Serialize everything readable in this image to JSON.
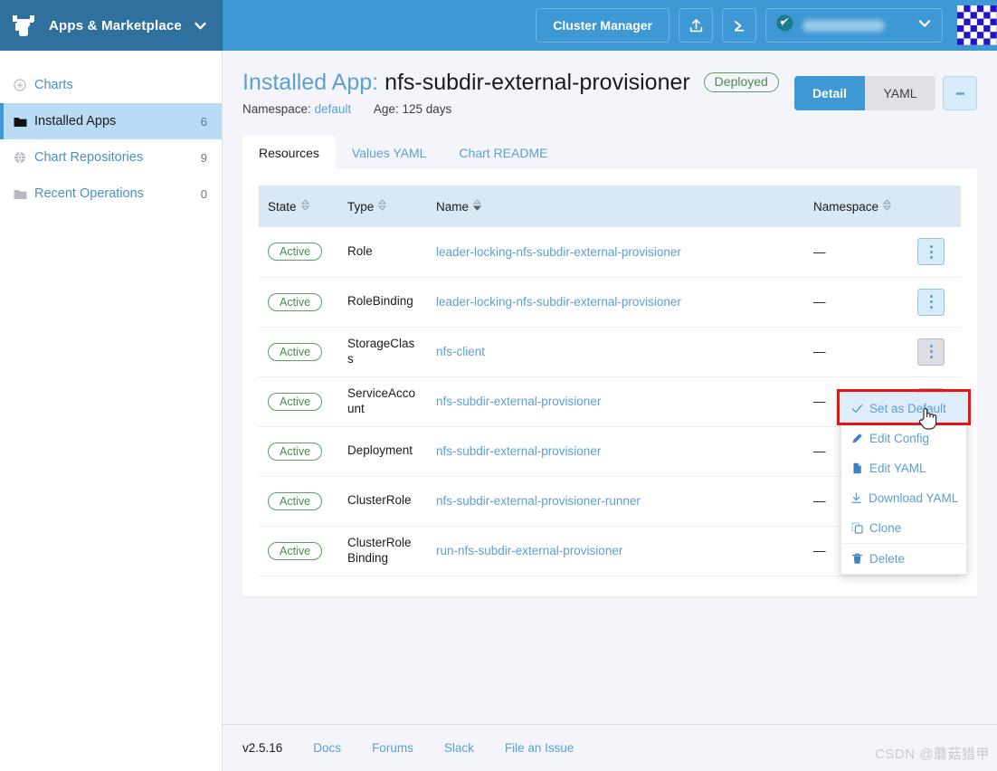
{
  "header": {
    "brand_title": "Apps & Marketplace",
    "brand_logo_icon": "rancher-cow-logo",
    "brand_caret_icon": "chevron-down-icon",
    "cluster_manager_label": "Cluster Manager",
    "import_yaml_icon": "upload-icon",
    "shell_icon": "terminal-icon",
    "cluster_selector_icon": "cluster-icon",
    "cluster_selector_value": "",
    "cluster_selector_caret_icon": "chevron-down-icon",
    "avatar_icon": "user-avatar"
  },
  "sidebar": {
    "items": [
      {
        "label": "Charts",
        "icon": "plus-circle-icon",
        "count": "",
        "active": false
      },
      {
        "label": "Installed Apps",
        "icon": "folder-icon",
        "count": "6",
        "active": true
      },
      {
        "label": "Chart Repositories",
        "icon": "globe-icon",
        "count": "9",
        "active": false
      },
      {
        "label": "Recent Operations",
        "icon": "folder-icon",
        "count": "0",
        "active": false
      }
    ]
  },
  "page": {
    "title_prefix": "Installed App:",
    "title_name": "nfs-subdir-external-provisioner",
    "status_badge": "Deployed",
    "namespace_label": "Namespace:",
    "namespace_value": "default",
    "age_label": "Age:",
    "age_value": "125 days",
    "view_detail": "Detail",
    "view_yaml": "YAML",
    "actions_icon": "kebab-menu-icon"
  },
  "tabs": [
    {
      "label": "Resources",
      "active": true
    },
    {
      "label": "Values YAML",
      "active": false
    },
    {
      "label": "Chart README",
      "active": false
    }
  ],
  "table": {
    "columns": [
      {
        "label": "State",
        "sort_icon": "sort-icon"
      },
      {
        "label": "Type",
        "sort_icon": "sort-icon"
      },
      {
        "label": "Name",
        "sort_icon": "sort-icon-active"
      },
      {
        "label": "Namespace",
        "sort_icon": "sort-icon"
      }
    ],
    "rows": [
      {
        "state": "Active",
        "type": "Role",
        "name": "leader-locking-nfs-subdir-external-provisioner",
        "namespace": "—",
        "menu_open": false
      },
      {
        "state": "Active",
        "type": "RoleBinding",
        "name": "leader-locking-nfs-subdir-external-provisioner",
        "namespace": "—",
        "menu_open": false
      },
      {
        "state": "Active",
        "type": "StorageClass",
        "name": "nfs-client",
        "namespace": "—",
        "menu_open": true
      },
      {
        "state": "Active",
        "type": "ServiceAccount",
        "name": "nfs-subdir-external-provisioner",
        "namespace": "—",
        "menu_open": false
      },
      {
        "state": "Active",
        "type": "Deployment",
        "name": "nfs-subdir-external-provisioner",
        "namespace": "—",
        "menu_open": false
      },
      {
        "state": "Active",
        "type": "ClusterRole",
        "name": "nfs-subdir-external-provisioner-runner",
        "namespace": "—",
        "menu_open": false
      },
      {
        "state": "Active",
        "type": "ClusterRoleBinding",
        "name": "run-nfs-subdir-external-provisioner",
        "namespace": "—",
        "menu_open": false
      }
    ]
  },
  "context_menu": {
    "items": [
      {
        "label": "Set as Default",
        "icon": "check-icon",
        "highlighted": true
      },
      {
        "label": "Edit Config",
        "icon": "pencil-icon",
        "highlighted": false
      },
      {
        "label": "Edit YAML",
        "icon": "file-icon",
        "highlighted": false
      },
      {
        "label": "Download YAML",
        "icon": "download-icon",
        "highlighted": false
      },
      {
        "label": "Clone",
        "icon": "copy-icon",
        "highlighted": false
      },
      {
        "label": "Delete",
        "icon": "trash-icon",
        "highlighted": false,
        "separator": true
      }
    ]
  },
  "footer": {
    "version": "v2.5.16",
    "links": [
      "Docs",
      "Forums",
      "Slack",
      "File an Issue"
    ]
  },
  "watermark": "CSDN @蘑菇猎甲",
  "colors": {
    "header_blue": "#3d98d3",
    "brand_blue": "#30709f",
    "link_blue": "#5b9fd4",
    "active_green": "#4a8b4f",
    "sidebar_active": "#b9dcf4",
    "table_header": "#d8e8f5",
    "annotation_red": "#ee1111"
  }
}
